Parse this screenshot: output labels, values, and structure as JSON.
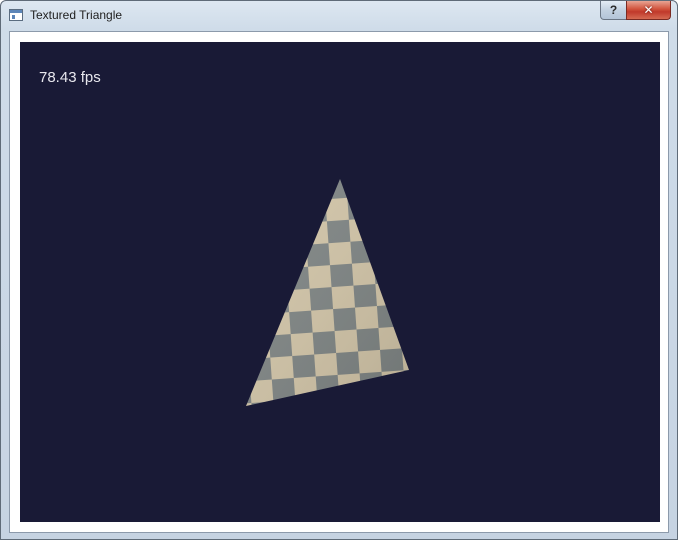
{
  "window": {
    "title": "Textured Triangle",
    "help_glyph": "?",
    "close_glyph": "✕",
    "icons": {
      "app": "app-window-icon",
      "help": "help-icon",
      "close": "close-icon"
    }
  },
  "viewport": {
    "background": "#191a36",
    "fps_text": "78.43 fps",
    "texture": {
      "pattern": "checkerboard",
      "light_color": "#d2c5a8",
      "dark_color": "#7f8584"
    }
  },
  "colors": {
    "close_button": "#c0392b"
  }
}
